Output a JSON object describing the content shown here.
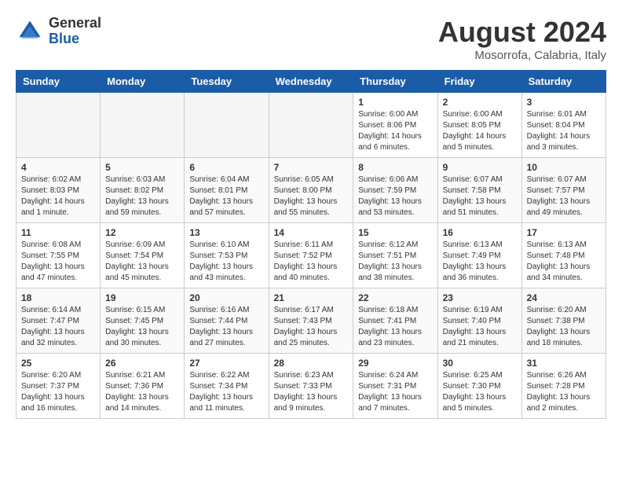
{
  "header": {
    "logo_general": "General",
    "logo_blue": "Blue",
    "title": "August 2024",
    "location": "Mosorrofa, Calabria, Italy"
  },
  "weekdays": [
    "Sunday",
    "Monday",
    "Tuesday",
    "Wednesday",
    "Thursday",
    "Friday",
    "Saturday"
  ],
  "weeks": [
    [
      {
        "day": "",
        "detail": ""
      },
      {
        "day": "",
        "detail": ""
      },
      {
        "day": "",
        "detail": ""
      },
      {
        "day": "",
        "detail": ""
      },
      {
        "day": "1",
        "detail": "Sunrise: 6:00 AM\nSunset: 8:06 PM\nDaylight: 14 hours\nand 6 minutes."
      },
      {
        "day": "2",
        "detail": "Sunrise: 6:00 AM\nSunset: 8:05 PM\nDaylight: 14 hours\nand 5 minutes."
      },
      {
        "day": "3",
        "detail": "Sunrise: 6:01 AM\nSunset: 8:04 PM\nDaylight: 14 hours\nand 3 minutes."
      }
    ],
    [
      {
        "day": "4",
        "detail": "Sunrise: 6:02 AM\nSunset: 8:03 PM\nDaylight: 14 hours\nand 1 minute."
      },
      {
        "day": "5",
        "detail": "Sunrise: 6:03 AM\nSunset: 8:02 PM\nDaylight: 13 hours\nand 59 minutes."
      },
      {
        "day": "6",
        "detail": "Sunrise: 6:04 AM\nSunset: 8:01 PM\nDaylight: 13 hours\nand 57 minutes."
      },
      {
        "day": "7",
        "detail": "Sunrise: 6:05 AM\nSunset: 8:00 PM\nDaylight: 13 hours\nand 55 minutes."
      },
      {
        "day": "8",
        "detail": "Sunrise: 6:06 AM\nSunset: 7:59 PM\nDaylight: 13 hours\nand 53 minutes."
      },
      {
        "day": "9",
        "detail": "Sunrise: 6:07 AM\nSunset: 7:58 PM\nDaylight: 13 hours\nand 51 minutes."
      },
      {
        "day": "10",
        "detail": "Sunrise: 6:07 AM\nSunset: 7:57 PM\nDaylight: 13 hours\nand 49 minutes."
      }
    ],
    [
      {
        "day": "11",
        "detail": "Sunrise: 6:08 AM\nSunset: 7:55 PM\nDaylight: 13 hours\nand 47 minutes."
      },
      {
        "day": "12",
        "detail": "Sunrise: 6:09 AM\nSunset: 7:54 PM\nDaylight: 13 hours\nand 45 minutes."
      },
      {
        "day": "13",
        "detail": "Sunrise: 6:10 AM\nSunset: 7:53 PM\nDaylight: 13 hours\nand 43 minutes."
      },
      {
        "day": "14",
        "detail": "Sunrise: 6:11 AM\nSunset: 7:52 PM\nDaylight: 13 hours\nand 40 minutes."
      },
      {
        "day": "15",
        "detail": "Sunrise: 6:12 AM\nSunset: 7:51 PM\nDaylight: 13 hours\nand 38 minutes."
      },
      {
        "day": "16",
        "detail": "Sunrise: 6:13 AM\nSunset: 7:49 PM\nDaylight: 13 hours\nand 36 minutes."
      },
      {
        "day": "17",
        "detail": "Sunrise: 6:13 AM\nSunset: 7:48 PM\nDaylight: 13 hours\nand 34 minutes."
      }
    ],
    [
      {
        "day": "18",
        "detail": "Sunrise: 6:14 AM\nSunset: 7:47 PM\nDaylight: 13 hours\nand 32 minutes."
      },
      {
        "day": "19",
        "detail": "Sunrise: 6:15 AM\nSunset: 7:45 PM\nDaylight: 13 hours\nand 30 minutes."
      },
      {
        "day": "20",
        "detail": "Sunrise: 6:16 AM\nSunset: 7:44 PM\nDaylight: 13 hours\nand 27 minutes."
      },
      {
        "day": "21",
        "detail": "Sunrise: 6:17 AM\nSunset: 7:43 PM\nDaylight: 13 hours\nand 25 minutes."
      },
      {
        "day": "22",
        "detail": "Sunrise: 6:18 AM\nSunset: 7:41 PM\nDaylight: 13 hours\nand 23 minutes."
      },
      {
        "day": "23",
        "detail": "Sunrise: 6:19 AM\nSunset: 7:40 PM\nDaylight: 13 hours\nand 21 minutes."
      },
      {
        "day": "24",
        "detail": "Sunrise: 6:20 AM\nSunset: 7:38 PM\nDaylight: 13 hours\nand 18 minutes."
      }
    ],
    [
      {
        "day": "25",
        "detail": "Sunrise: 6:20 AM\nSunset: 7:37 PM\nDaylight: 13 hours\nand 16 minutes."
      },
      {
        "day": "26",
        "detail": "Sunrise: 6:21 AM\nSunset: 7:36 PM\nDaylight: 13 hours\nand 14 minutes."
      },
      {
        "day": "27",
        "detail": "Sunrise: 6:22 AM\nSunset: 7:34 PM\nDaylight: 13 hours\nand 11 minutes."
      },
      {
        "day": "28",
        "detail": "Sunrise: 6:23 AM\nSunset: 7:33 PM\nDaylight: 13 hours\nand 9 minutes."
      },
      {
        "day": "29",
        "detail": "Sunrise: 6:24 AM\nSunset: 7:31 PM\nDaylight: 13 hours\nand 7 minutes."
      },
      {
        "day": "30",
        "detail": "Sunrise: 6:25 AM\nSunset: 7:30 PM\nDaylight: 13 hours\nand 5 minutes."
      },
      {
        "day": "31",
        "detail": "Sunrise: 6:26 AM\nSunset: 7:28 PM\nDaylight: 13 hours\nand 2 minutes."
      }
    ]
  ]
}
